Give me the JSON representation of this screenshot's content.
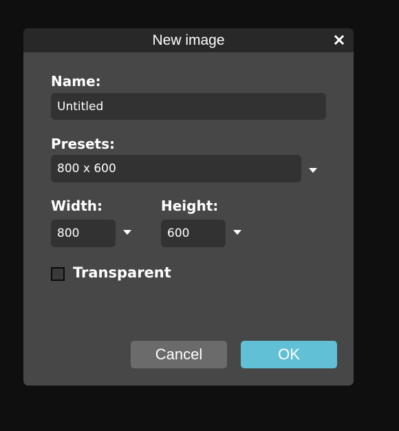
{
  "dialog": {
    "title": "New image",
    "close_icon": "close-icon"
  },
  "name": {
    "label": "Name:",
    "value": "Untitled"
  },
  "presets": {
    "label": "Presets:",
    "selected": "800 x 600"
  },
  "width": {
    "label": "Width:",
    "value": "800"
  },
  "height": {
    "label": "Height:",
    "value": "600"
  },
  "transparent": {
    "label": "Transparent",
    "checked": false
  },
  "buttons": {
    "cancel": "Cancel",
    "ok": "OK"
  },
  "colors": {
    "ok_button": "#62c0d6",
    "cancel_button": "#6b6b6b",
    "dialog_bg": "#474747",
    "titlebar_bg": "#282828"
  }
}
